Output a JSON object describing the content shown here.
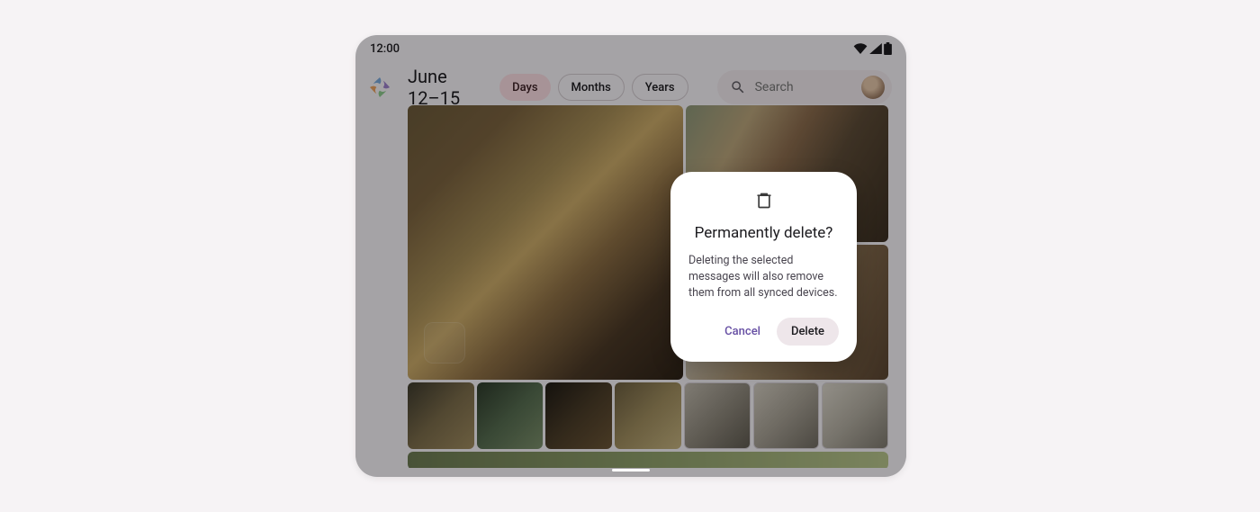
{
  "status": {
    "time": "12:00"
  },
  "header": {
    "date_range": "June 12–15",
    "tabs": [
      {
        "label": "Days",
        "selected": true
      },
      {
        "label": "Months",
        "selected": false
      },
      {
        "label": "Years",
        "selected": false
      }
    ],
    "search_placeholder": "Search"
  },
  "dialog": {
    "icon": "delete-icon",
    "title": "Permanently delete?",
    "body": "Deleting the selected messages will also remove them from all synced devices.",
    "cancel_label": "Cancel",
    "confirm_label": "Delete"
  }
}
